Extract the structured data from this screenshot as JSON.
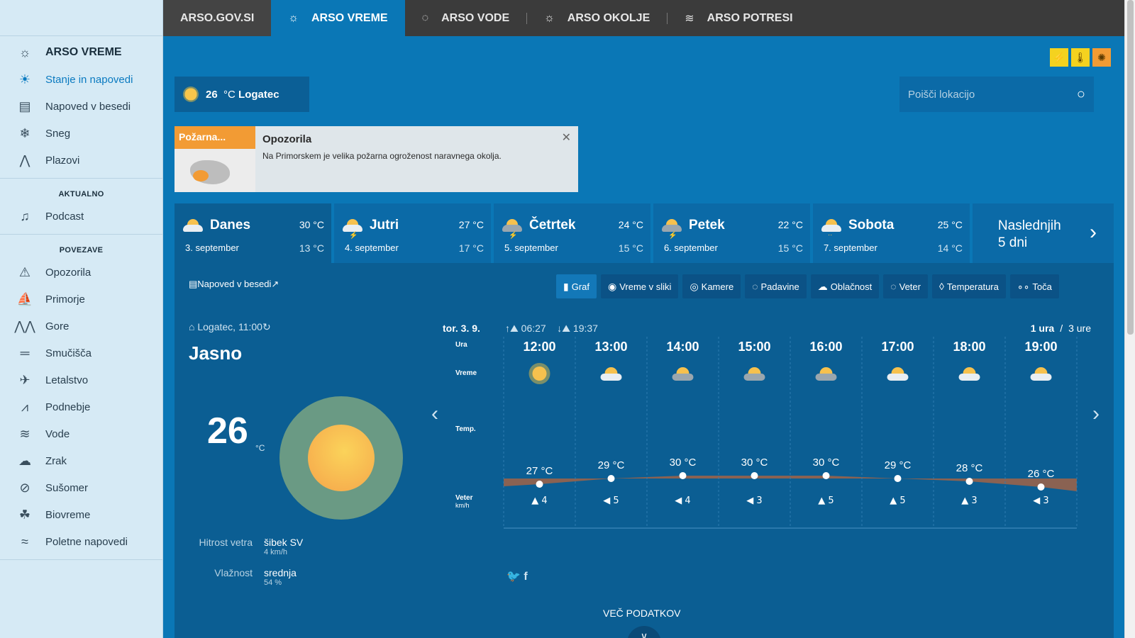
{
  "topnav": {
    "items": [
      {
        "label": "ARSO.GOV.SI",
        "icon": ""
      },
      {
        "label": "ARSO VREME",
        "icon": "sun-icon"
      },
      {
        "label": "ARSO VODE",
        "icon": "drop-icon"
      },
      {
        "label": "ARSO OKOLJE",
        "icon": "env-icon"
      },
      {
        "label": "ARSO POTRESI",
        "icon": "quake-icon"
      }
    ]
  },
  "sidebar": {
    "title": "ARSO VREME",
    "main": [
      "Stanje in napovedi",
      "Napoved v besedi",
      "Sneg",
      "Plazovi"
    ],
    "aktualno_heading": "AKTUALNO",
    "aktualno": [
      "Podcast"
    ],
    "povezave_heading": "POVEZAVE",
    "povezave": [
      "Opozorila",
      "Primorje",
      "Gore",
      "Smučišča",
      "Letalstvo",
      "Podnebje",
      "Vode",
      "Zrak",
      "Sušomer",
      "Biovreme",
      "Poletne napovedi"
    ]
  },
  "current": {
    "temp": "26",
    "unit": "°C",
    "location": "Logatec",
    "meta": "Logatec, 11:00",
    "condition": "Jasno",
    "wind_label": "Hitrost vetra",
    "wind_value": "šibek SV",
    "wind_sub": "4 km/h",
    "hum_label": "Vlažnost",
    "hum_value": "srednja",
    "hum_sub": "54 %"
  },
  "search": {
    "placeholder": "Poišči lokacijo"
  },
  "warning": {
    "tag": "Požarna...",
    "title": "Opozorila",
    "text": "Na Primorskem je velika požarna ogroženost naravnega okolja."
  },
  "days": [
    {
      "name": "Danes",
      "date": "3. september",
      "max": "30 °C",
      "min": "13 °C"
    },
    {
      "name": "Jutri",
      "date": "4. september",
      "max": "27 °C",
      "min": "17 °C"
    },
    {
      "name": "Četrtek",
      "date": "5. september",
      "max": "24 °C",
      "min": "15 °C"
    },
    {
      "name": "Petek",
      "date": "6. september",
      "max": "22 °C",
      "min": "15 °C"
    },
    {
      "name": "Sobota",
      "date": "7. september",
      "max": "25 °C",
      "min": "14 °C"
    }
  ],
  "next_days": {
    "line1": "Naslednjih",
    "line2": "5 dni"
  },
  "panel": {
    "np_link": "Napoved v besedi",
    "tabs": [
      "Graf",
      "Vreme v sliki",
      "Kamere",
      "Padavine",
      "Oblačnost",
      "Veter",
      "Temperatura",
      "Toča"
    ]
  },
  "forecast": {
    "date": "tor. 3. 9.",
    "sunrise": "06:27",
    "sunset": "19:37",
    "res_1": "1 ura",
    "res_sep": "/",
    "res_3": "3 ure",
    "row_ura": "Ura",
    "row_vreme": "Vreme",
    "row_temp": "Temp.",
    "row_veter": "Veter",
    "row_veter_unit": "km/h",
    "hours": [
      "12:00",
      "13:00",
      "14:00",
      "15:00",
      "16:00",
      "17:00",
      "18:00",
      "19:00"
    ],
    "temps": [
      27,
      29,
      30,
      30,
      30,
      29,
      28,
      26
    ],
    "temp_labels": [
      "27 °C",
      "29 °C",
      "30 °C",
      "30 °C",
      "30 °C",
      "29 °C",
      "28 °C",
      "26 °C"
    ],
    "wind": [
      "4",
      "5",
      "4",
      "3",
      "5",
      "5",
      "3",
      "3"
    ],
    "wind_dir": [
      "▲",
      "◀",
      "◀",
      "◀",
      "▲",
      "▲",
      "▲",
      "◀"
    ]
  },
  "more_label": "VEČ PODATKOV",
  "colors": {
    "nav_bg": "#3b3b3b",
    "main_bg": "#0a77b6",
    "panel_bg": "#0b5e93",
    "sidebar_bg": "#d6eaf5",
    "temp_area": "#8a6252"
  }
}
